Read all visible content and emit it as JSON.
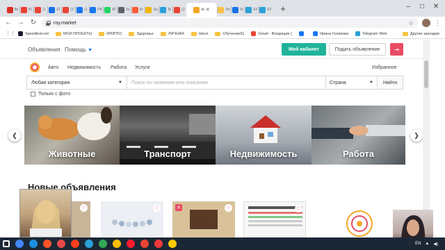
{
  "browser": {
    "tabs": [
      {
        "label": "Вх",
        "color": "#d93025"
      },
      {
        "label": "Ю",
        "color": "#ea4335"
      },
      {
        "label": "(1",
        "color": "#ea4335"
      },
      {
        "label": "12",
        "color": "#1a73e8"
      },
      {
        "label": "(3",
        "color": "#ea4335"
      },
      {
        "label": "(1",
        "color": "#1877f2"
      },
      {
        "label": "FB",
        "color": "#1877f2"
      },
      {
        "label": "W",
        "color": "#25d366"
      },
      {
        "label": "Зн",
        "color": "#5f6368"
      },
      {
        "label": "Kr",
        "color": "#ff5a36"
      },
      {
        "label": "Su",
        "color": "#f4b400"
      },
      {
        "label": "Te",
        "color": "#2aa1da"
      },
      {
        "label": "(2",
        "color": "#ea4335"
      },
      {
        "label": "ro",
        "color": "#f5a623",
        "active": true
      },
      {
        "label": "Ло",
        "color": "#f6c344"
      },
      {
        "label": "Ус",
        "color": "#1a73e8"
      },
      {
        "label": "EF",
        "color": "#2aa1da"
      },
      {
        "label": "EF",
        "color": "#2aa1da"
      }
    ],
    "new_tab": "+",
    "window_controls": {
      "minimize": "–",
      "maximize": "□",
      "close": "✕"
    },
    "url": "roy.market",
    "bookmarks": [
      {
        "label": "Speedtest.net",
        "icon": "speedtest-icon",
        "color": "#1a1a2e"
      },
      {
        "label": "МОИ ПРОЕКТЫ",
        "icon": "folder-icon"
      },
      {
        "label": "КРИПТО",
        "icon": "folder-icon"
      },
      {
        "label": "Здоровье",
        "icon": "folder-icon"
      },
      {
        "label": "ЛИЧНАЯ",
        "icon": "folder-icon"
      },
      {
        "label": "Школ",
        "icon": "folder-icon"
      },
      {
        "label": "ОбучениеIG",
        "icon": "folder-icon"
      },
      {
        "label": "Gmail - Входящие (",
        "icon": "gmail-icon",
        "color": "#ea4335"
      },
      {
        "label": "",
        "icon": "facebook-icon",
        "color": "#1877f2"
      },
      {
        "label": "Ирина Голикова",
        "icon": "facebook-icon",
        "color": "#1877f2"
      },
      {
        "label": "Telegram Web",
        "icon": "telegram-icon",
        "color": "#2aa1da"
      }
    ],
    "bookmarks_more": "Другие закладки"
  },
  "site": {
    "header": {
      "ads_link": "Объявления",
      "help_link": "Помощь",
      "cabinet_button": "Мой кабинет",
      "post_ad_button": "Подать объявление",
      "logout_icon": "logout-icon"
    },
    "categories": [
      "Авто",
      "Недвижимость",
      "Работа",
      "Услуги"
    ],
    "favorites": "Избранное",
    "search": {
      "category_value": "Любая категория",
      "placeholder": "Поиск по названию или описанию",
      "country_value": "Страна",
      "find_button": "Найти"
    },
    "photo_only_label": "Только с фото",
    "carousel": [
      "Животные",
      "Транспорт",
      "Недвижимость",
      "Работа"
    ],
    "new_ads_title": "Новые объявления"
  },
  "taskbar": {
    "icons": [
      {
        "name": "start-icon",
        "color": "#1b2735"
      },
      {
        "name": "chrome-icon",
        "color": "#4285f4"
      },
      {
        "name": "onedrive-icon",
        "color": "#1e8fe0"
      },
      {
        "name": "brave-icon",
        "color": "#fb542b"
      },
      {
        "name": "office-icon",
        "color": "#e8484a"
      },
      {
        "name": "yandex-icon",
        "color": "#fc3f1d"
      },
      {
        "name": "telegram-icon",
        "color": "#2aa1da"
      },
      {
        "name": "chrome-icon",
        "color": "#34a853"
      },
      {
        "name": "chrome-icon",
        "color": "#fbbc05"
      },
      {
        "name": "opera-icon",
        "color": "#ff1b2d"
      },
      {
        "name": "chrome-icon",
        "color": "#ea4335"
      },
      {
        "name": "vivaldi-icon",
        "color": "#ef3939"
      },
      {
        "name": "yandex-icon",
        "color": "#ffcc00"
      }
    ],
    "lang": "EN"
  }
}
